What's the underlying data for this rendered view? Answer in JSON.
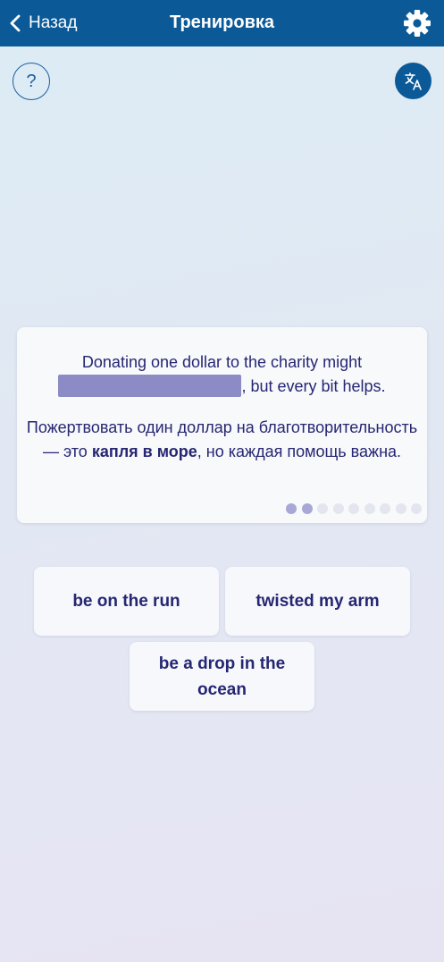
{
  "header": {
    "back_label": "Назад",
    "title": "Тренировка",
    "back_icon": "chevron-left-icon",
    "settings_icon": "gear-icon",
    "bg_color": "#0b5a97"
  },
  "toolbar": {
    "help_label": "?",
    "translate_icon": "translate-icon"
  },
  "exercise": {
    "sentence_before": "Donating one dollar to the charity might",
    "sentence_after": ", but every bit helps.",
    "translation_before": "Пожертвовать один доллар на благотворительность — это ",
    "translation_highlight": "капля в море",
    "translation_after": ", но каждая помощь важна.",
    "progress": {
      "total": 9,
      "current": 2
    }
  },
  "options": [
    {
      "label": "be on the run"
    },
    {
      "label": "twisted my arm"
    },
    {
      "label": "be a drop in the ocean"
    }
  ],
  "colors": {
    "accent": "#0b5a97",
    "text": "#262673",
    "blank": "#8d8bc6",
    "dot_active": "#a8a7d6",
    "dot_inactive": "#e4e6ef"
  }
}
